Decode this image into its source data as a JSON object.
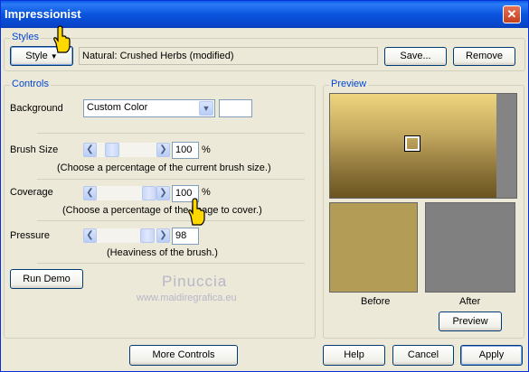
{
  "window": {
    "title": "Impressionist",
    "close_glyph": "✕"
  },
  "styles": {
    "legend": "Styles",
    "style_button": "Style",
    "style_name": "Natural: Crushed Herbs (modified)",
    "save_button": "Save...",
    "remove_button": "Remove"
  },
  "controls": {
    "legend": "Controls",
    "background_label": "Background",
    "background_value": "Custom Color",
    "background_swatch_color": "#ffffff",
    "brush_size": {
      "label": "Brush Size",
      "value": "100",
      "unit": "%",
      "hint": "(Choose a percentage of the current brush size.)",
      "level": 0.18
    },
    "coverage": {
      "label": "Coverage",
      "value": "100",
      "unit": "%",
      "hint": "(Choose a percentage of the image to cover.)",
      "level": 1.0
    },
    "pressure": {
      "label": "Pressure",
      "value": "98",
      "hint": "(Heaviness of the brush.)",
      "level": 0.95
    },
    "run_demo_button": "Run Demo"
  },
  "preview": {
    "legend": "Preview",
    "before_label": "Before",
    "after_label": "After",
    "preview_button": "Preview",
    "before_color": "#b29c56",
    "after_color": "#808080"
  },
  "watermark": {
    "line1": "Pinuccia",
    "line2": "www.maidiregrafica.eu"
  },
  "footer": {
    "more_controls_button": "More Controls",
    "help_button": "Help",
    "cancel_button": "Cancel",
    "apply_button": "Apply"
  },
  "icons": [
    "close-icon",
    "hand-cursor-icon",
    "dropdown-arrow-icon",
    "left-arrow-icon",
    "right-arrow-icon"
  ]
}
